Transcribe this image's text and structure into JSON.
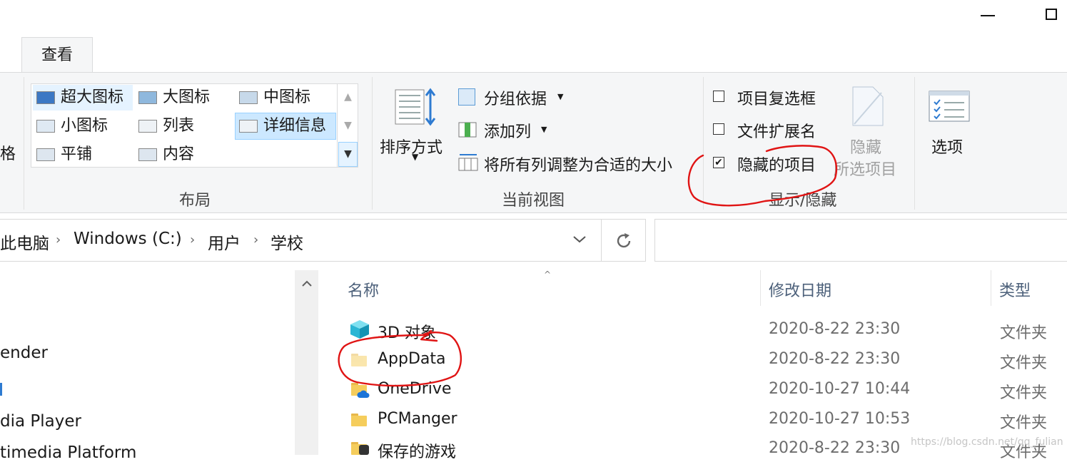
{
  "ribbon": {
    "active_tab": "查看",
    "left_cut_text": "格",
    "layout": {
      "group_label": "布局",
      "items": [
        {
          "label": "超大图标",
          "icon": "extra-large-icons-icon",
          "state": "hover"
        },
        {
          "label": "大图标",
          "icon": "large-icons-icon",
          "state": ""
        },
        {
          "label": "中图标",
          "icon": "medium-icons-icon",
          "state": ""
        },
        {
          "label": "小图标",
          "icon": "small-icons-icon",
          "state": ""
        },
        {
          "label": "列表",
          "icon": "list-icon",
          "state": ""
        },
        {
          "label": "详细信息",
          "icon": "details-icon",
          "state": "selected"
        },
        {
          "label": "平铺",
          "icon": "tiles-icon",
          "state": ""
        },
        {
          "label": "内容",
          "icon": "content-icon",
          "state": ""
        }
      ]
    },
    "current_view": {
      "group_label": "当前视图",
      "sort_label": "排序方式",
      "group_by_label": "分组依据",
      "add_column_label": "添加列",
      "fit_columns_label": "将所有列调整为合适的大小"
    },
    "show_hide": {
      "group_label": "显示/隐藏",
      "item_checkboxes": {
        "label": "项目复选框",
        "checked": false
      },
      "file_extensions": {
        "label": "文件扩展名",
        "checked": false
      },
      "hidden_items": {
        "label": "隐藏的项目",
        "checked": true
      },
      "hide_selected_line1": "隐藏",
      "hide_selected_line2": "所选项目"
    },
    "options_label": "选项"
  },
  "address": {
    "crumbs": [
      "此电脑",
      "Windows (C:)",
      "用户",
      "学校"
    ],
    "refresh_icon": "refresh-icon"
  },
  "nav": {
    "items": [
      "ender",
      "dia Player",
      "timedia Platform"
    ]
  },
  "file_list": {
    "columns": {
      "name": "名称",
      "date": "修改日期",
      "type": "类型"
    },
    "rows": [
      {
        "name": "3D 对象",
        "date": "2020-8-22 23:30",
        "type": "文件夹",
        "icon": "3d-objects-icon"
      },
      {
        "name": "AppData",
        "date": "2020-8-22 23:30",
        "type": "文件夹",
        "icon": "hidden-folder-icon"
      },
      {
        "name": "OneDrive",
        "date": "2020-10-27 10:44",
        "type": "文件夹",
        "icon": "onedrive-folder-icon"
      },
      {
        "name": "PCManger",
        "date": "2020-10-27 10:53",
        "type": "文件夹",
        "icon": "folder-icon"
      },
      {
        "name": "保存的游戏",
        "date": "2020-8-22 23:30",
        "type": "文件夹",
        "icon": "saved-games-icon"
      }
    ]
  },
  "watermark": "https://blog.csdn.net/qq_fulian",
  "colors": {
    "ribbon_bg": "#f5f6f7",
    "selected_bg": "#cce8ff",
    "annotation_red": "#e01414",
    "header_text": "#4c607a"
  }
}
